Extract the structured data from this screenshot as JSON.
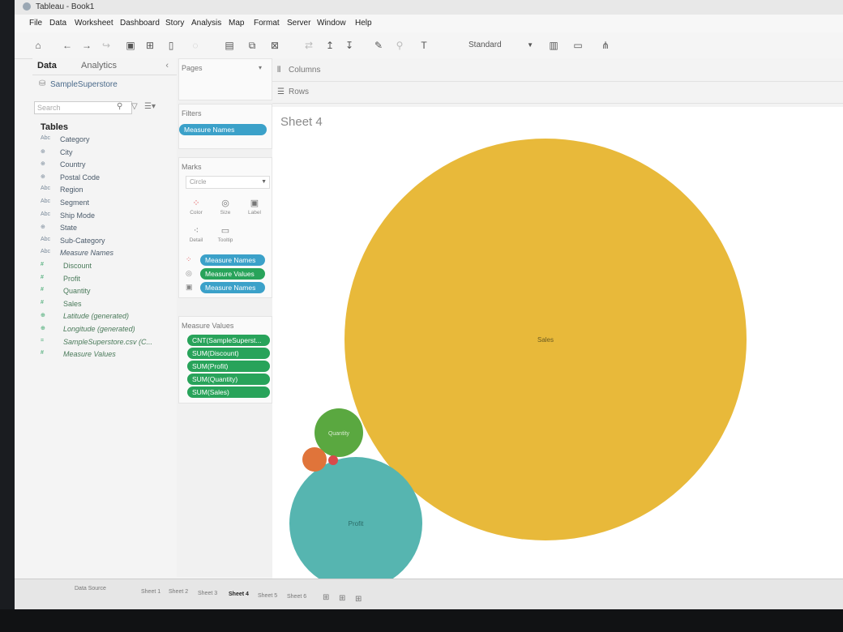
{
  "window": {
    "title": "Tableau - Book1"
  },
  "menu": [
    "File",
    "Data",
    "Worksheet",
    "Dashboard",
    "Story",
    "Analysis",
    "Map",
    "Format",
    "Server",
    "Window",
    "Help"
  ],
  "toolbar": {
    "view_size": "Standard"
  },
  "data_pane": {
    "tab_data": "Data",
    "tab_analytics": "Analytics",
    "data_source": "SampleSuperstore",
    "search_placeholder": "Search",
    "tables_heading": "Tables",
    "dimensions": [
      {
        "type": "Abc",
        "name": "Category"
      },
      {
        "type": "⊕",
        "name": "City"
      },
      {
        "type": "⊕",
        "name": "Country"
      },
      {
        "type": "⊕",
        "name": "Postal Code"
      },
      {
        "type": "Abc",
        "name": "Region"
      },
      {
        "type": "Abc",
        "name": "Segment"
      },
      {
        "type": "Abc",
        "name": "Ship Mode"
      },
      {
        "type": "⊕",
        "name": "State"
      },
      {
        "type": "Abc",
        "name": "Sub-Category"
      },
      {
        "type": "Abc",
        "name": "Measure Names"
      }
    ],
    "measures": [
      {
        "type": "#",
        "name": "Discount"
      },
      {
        "type": "#",
        "name": "Profit"
      },
      {
        "type": "#",
        "name": "Quantity"
      },
      {
        "type": "#",
        "name": "Sales"
      },
      {
        "type": "⊕",
        "name": "Latitude (generated)"
      },
      {
        "type": "⊕",
        "name": "Longitude (generated)"
      },
      {
        "type": "=",
        "name": "SampleSuperstore.csv (C..."
      },
      {
        "type": "#",
        "name": "Measure Values"
      }
    ]
  },
  "cards": {
    "pages": "Pages",
    "filters": "Filters",
    "filter_pill": "Measure Names",
    "marks": "Marks",
    "mark_type": "Circle",
    "mark_buttons": [
      "Color",
      "Size",
      "Label",
      "Detail",
      "Tooltip"
    ],
    "mark_pills": [
      "Measure Names",
      "Measure Values",
      "Measure Names"
    ],
    "measure_values_title": "Measure Values",
    "measure_values": [
      "CNT(SampleSuperst...",
      "SUM(Discount)",
      "SUM(Profit)",
      "SUM(Quantity)",
      "SUM(Sales)"
    ]
  },
  "shelves": {
    "columns": "Columns",
    "rows": "Rows"
  },
  "sheet": {
    "title": "Sheet 4"
  },
  "bubbles": [
    {
      "label": "Sales",
      "color": "#e8b93a"
    },
    {
      "label": "Profit",
      "color": "#56b5b0"
    },
    {
      "label": "Quantity",
      "color": "#5aa840"
    },
    {
      "label": "",
      "color": "#e0743a"
    },
    {
      "label": "",
      "color": "#d94b4b"
    }
  ],
  "bottom": {
    "data_source_tab": "Data Source",
    "sheet_tabs": [
      "Sheet 1",
      "Sheet 2",
      "Sheet 3",
      "Sheet 4",
      "Sheet 5",
      "Sheet 6"
    ],
    "active_sheet": "Sheet 4"
  }
}
